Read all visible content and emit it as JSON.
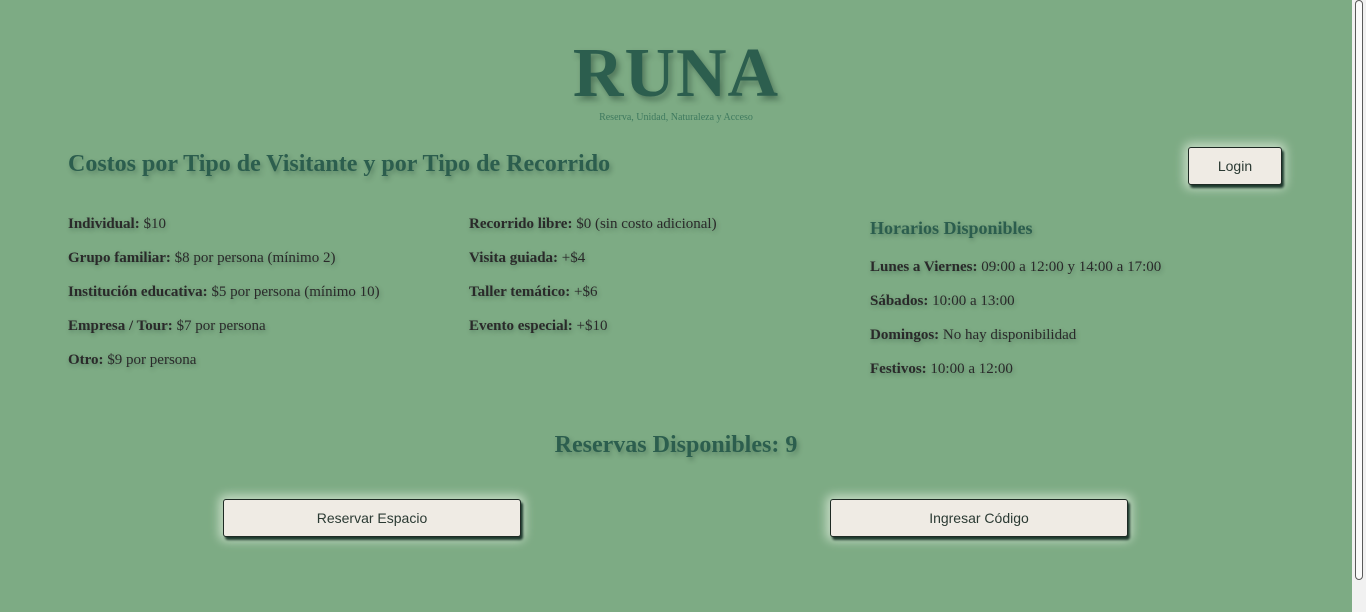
{
  "brand": {
    "title": "RUNA",
    "tagline": "Reserva, Unidad, Naturaleza y Acceso"
  },
  "header": {
    "login_label": "Login"
  },
  "costs": {
    "title": "Costos por Tipo de Visitante y por Tipo de Recorrido",
    "visitors": [
      {
        "label": "Individual:",
        "value": " $10"
      },
      {
        "label": "Grupo familiar:",
        "value": " $8 por persona (mínimo 2)"
      },
      {
        "label": "Institución educativa:",
        "value": " $5 por persona (mínimo 10)"
      },
      {
        "label": "Empresa / Tour:",
        "value": " $7 por persona"
      },
      {
        "label": "Otro:",
        "value": " $9 por persona"
      }
    ],
    "tours": [
      {
        "label": "Recorrido libre:",
        "value": " $0 (sin costo adicional)"
      },
      {
        "label": "Visita guiada:",
        "value": " +$4"
      },
      {
        "label": "Taller temático:",
        "value": " +$6"
      },
      {
        "label": "Evento especial:",
        "value": " +$10"
      }
    ]
  },
  "schedule": {
    "title": "Horarios Disponibles",
    "items": [
      {
        "label": "Lunes a Viernes:",
        "value": " 09:00 a 12:00 y 14:00 a 17:00"
      },
      {
        "label": "Sábados:",
        "value": " 10:00 a 13:00"
      },
      {
        "label": "Domingos:",
        "value": " No hay disponibilidad"
      },
      {
        "label": "Festivos:",
        "value": " 10:00 a 12:00"
      }
    ]
  },
  "reservations": {
    "available_text": "Reservas Disponibles: 9",
    "reserve_button": "Reservar Espacio",
    "code_button": "Ingresar Código"
  }
}
